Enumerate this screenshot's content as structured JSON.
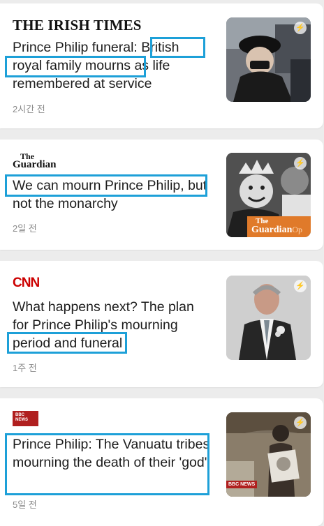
{
  "articles": [
    {
      "source": "THE IRISH TIMES",
      "headline": "Prince Philip funeral: British royal family mourns as life remembered at service",
      "time": "2시간 전",
      "thumb": "queen-funeral-photo"
    },
    {
      "source_line1": "The",
      "source_line2": "Guardian",
      "headline": "We can mourn Prince Philip, but not the monarchy",
      "time": "2일 전",
      "thumb": "queen-and-philip-guardian-opinion-photo",
      "thumb_badge_line1": "The",
      "thumb_badge_line2": "Guardian",
      "thumb_badge_line3": "Op"
    },
    {
      "source": "CNN",
      "headline": "What happens next? The plan for Prince Philip's mourning period and funeral",
      "time": "1주 전",
      "thumb": "prince-philip-portrait-photo"
    },
    {
      "source_line1": "BBC",
      "source_line2": "NEWS",
      "headline": "Prince Philip: The Vanuatu tribes mourning the death of their 'god'",
      "time": "5일 전",
      "thumb": "vanuatu-tribesman-photo",
      "thumb_badge": "BBC NEWS"
    }
  ],
  "icons": {
    "instant": "lightning-icon"
  },
  "colors": {
    "highlight": "#1da0d8",
    "cnn_red": "#cc0000",
    "bbc_red": "#b01f1f"
  }
}
